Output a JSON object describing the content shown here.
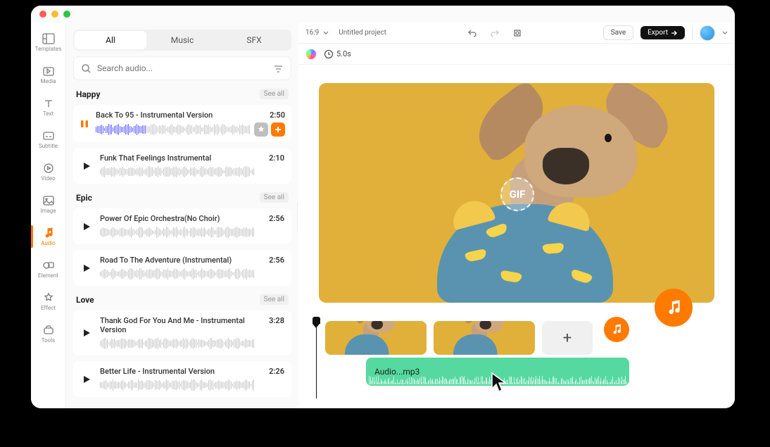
{
  "sidebar": {
    "items": [
      {
        "label": "Templates"
      },
      {
        "label": "Media"
      },
      {
        "label": "Text"
      },
      {
        "label": "Subtitle"
      },
      {
        "label": "Video"
      },
      {
        "label": "Image"
      },
      {
        "label": "Audio"
      },
      {
        "label": "Element"
      },
      {
        "label": "Effect"
      },
      {
        "label": "Tools"
      }
    ]
  },
  "panel": {
    "tabs": {
      "all": "All",
      "music": "Music",
      "sfx": "SFX"
    },
    "search_placeholder": "Search audio...",
    "see_all": "See all",
    "categories": [
      {
        "title": "Happy",
        "tracks": [
          {
            "title": "Back To 95 - Instrumental Version",
            "duration": "2:50",
            "playing": true
          },
          {
            "title": "Funk That Feelings Instrumental",
            "duration": "2:10"
          }
        ]
      },
      {
        "title": "Epic",
        "tracks": [
          {
            "title": "Power Of Epic Orchestra(No Choir)",
            "duration": "2:56"
          },
          {
            "title": "Road To The Adventure (Instrumental)",
            "duration": "2:56"
          }
        ]
      },
      {
        "title": "Love",
        "tracks": [
          {
            "title": "Thank God For You And Me - Instrumental Version",
            "duration": "3:28"
          },
          {
            "title": "Better Life - Instrumental Version",
            "duration": "2:26"
          }
        ]
      }
    ]
  },
  "topbar": {
    "aspect": "16:9",
    "project": "Untitled project",
    "save": "Save",
    "export": "Export"
  },
  "context": {
    "duration": "5.0s"
  },
  "preview": {
    "badge": "GIF"
  },
  "timeline": {
    "audio_clip_label": "Audio...mp3"
  }
}
